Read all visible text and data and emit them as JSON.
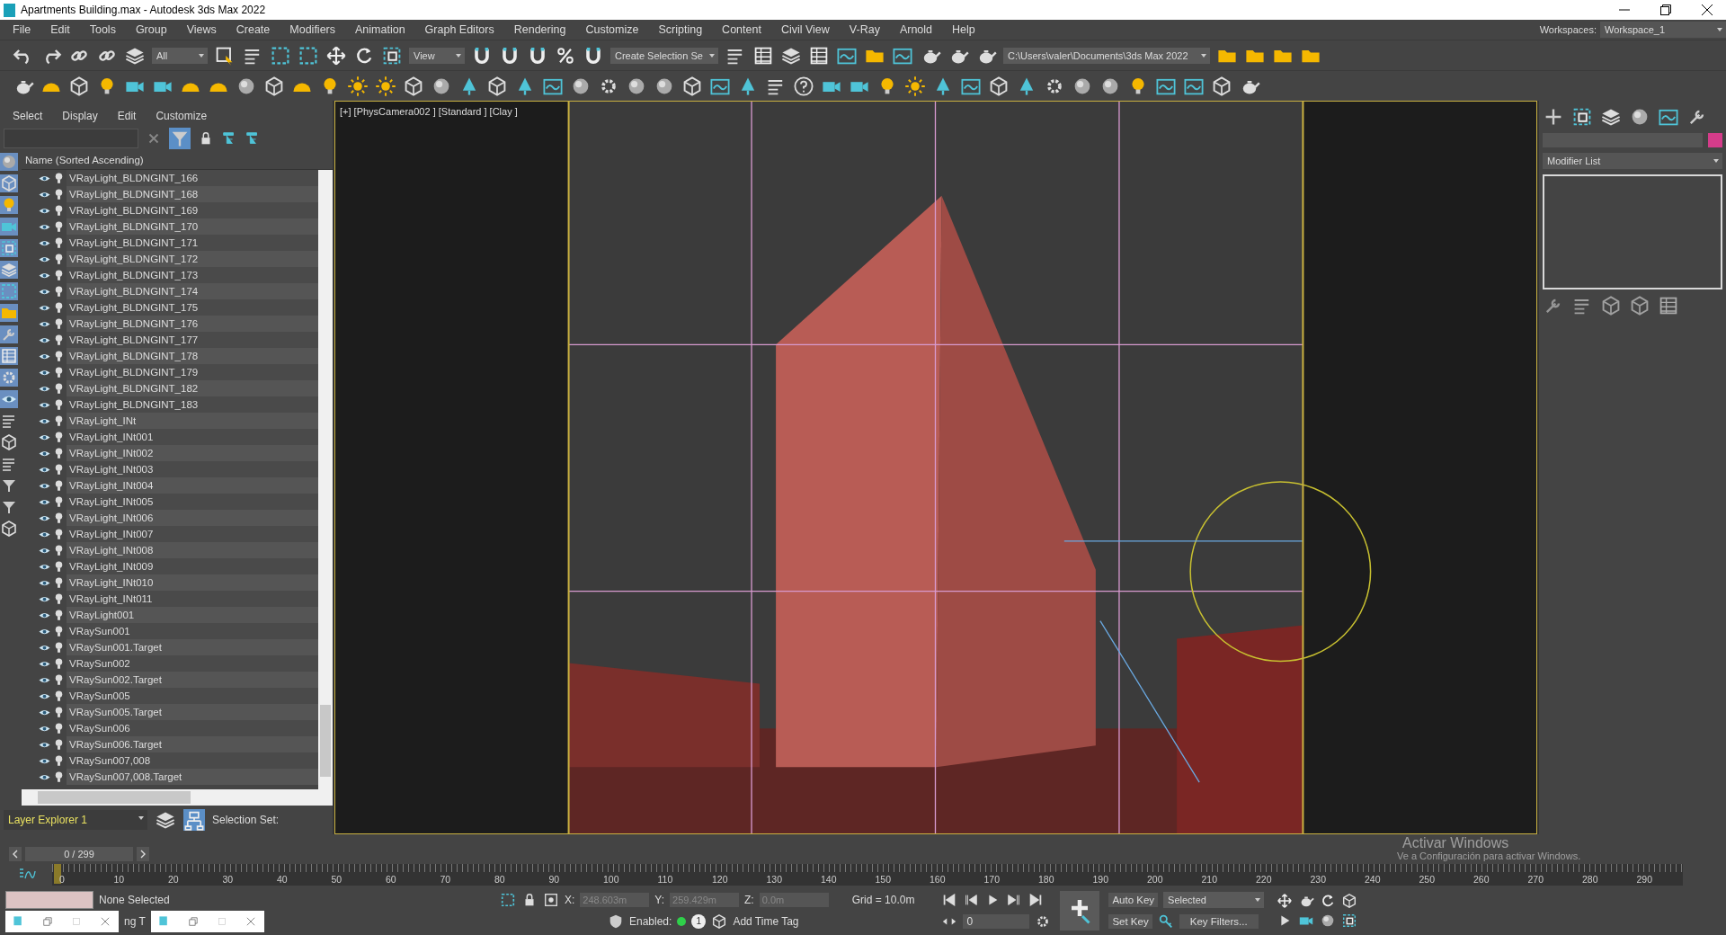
{
  "window": {
    "title": "Apartments Building.max - Autodesk 3ds Max 2022"
  },
  "menu": [
    "File",
    "Edit",
    "Tools",
    "Group",
    "Views",
    "Create",
    "Modifiers",
    "Animation",
    "Graph Editors",
    "Rendering",
    "Customize",
    "Scripting",
    "Content",
    "Civil View",
    "V-Ray",
    "Arnold",
    "Help"
  ],
  "workspaces": {
    "label": "Workspaces:",
    "value": "Workspace_1"
  },
  "toolbar": {
    "selection_filter": "All",
    "reference_coordinate": "View",
    "named_selection": "Create Selection Se",
    "project_path": "C:\\Users\\valer\\Documents\\3ds Max 2022"
  },
  "scene_explorer": {
    "menu": [
      "Select",
      "Display",
      "Edit",
      "Customize"
    ],
    "filter_on": true,
    "column": "Name (Sorted Ascending)",
    "items": [
      "VRayLight_BLDNGINT_166",
      "VRayLight_BLDNGINT_168",
      "VRayLight_BLDNGINT_169",
      "VRayLight_BLDNGINT_170",
      "VRayLight_BLDNGINT_171",
      "VRayLight_BLDNGINT_172",
      "VRayLight_BLDNGINT_173",
      "VRayLight_BLDNGINT_174",
      "VRayLight_BLDNGINT_175",
      "VRayLight_BLDNGINT_176",
      "VRayLight_BLDNGINT_177",
      "VRayLight_BLDNGINT_178",
      "VRayLight_BLDNGINT_179",
      "VRayLight_BLDNGINT_182",
      "VRayLight_BLDNGINT_183",
      "VRayLight_INt",
      "VRayLight_INt001",
      "VRayLight_INt002",
      "VRayLight_INt003",
      "VRayLight_INt004",
      "VRayLight_INt005",
      "VRayLight_INt006",
      "VRayLight_INt007",
      "VRayLight_INt008",
      "VRayLight_INt009",
      "VRayLight_INt010",
      "VRayLight_INt011",
      "VRayLight001",
      "VRaySun001",
      "VRaySun001.Target",
      "VRaySun002",
      "VRaySun002.Target",
      "VRaySun005",
      "VRaySun005.Target",
      "VRaySun006",
      "VRaySun006.Target",
      "VRaySun007,008",
      "VRaySun007,008.Target"
    ],
    "explorer_name": "Layer Explorer 1",
    "selection_set_label": "Selection Set:"
  },
  "viewport": {
    "label": "[+] [PhysCamera002 ] [Standard ] [Clay ]"
  },
  "command_panel": {
    "modifier_list": "Modifier List"
  },
  "timeline": {
    "frame_counter": "0 / 299",
    "ticks": [
      "0",
      "10",
      "20",
      "30",
      "40",
      "50",
      "60",
      "70",
      "80",
      "90",
      "100",
      "110",
      "120",
      "130",
      "140",
      "150",
      "160",
      "170",
      "180",
      "190",
      "200",
      "210",
      "220",
      "230",
      "240",
      "250",
      "260",
      "270",
      "280",
      "290"
    ]
  },
  "status": {
    "selection": "None Selected",
    "partial_text": "ng T",
    "x_label": "X:",
    "x": "248.603m",
    "y_label": "Y:",
    "y": "259.429m",
    "z_label": "Z:",
    "z": "0.0m",
    "grid": "Grid = 10.0m",
    "enabled_label": "Enabled:",
    "enabled_count": "1",
    "add_time_tag": "Add Time Tag",
    "frame": "0",
    "auto_key": "Auto Key",
    "set_key_filter": "Selected",
    "set_key": "Set Key",
    "key_filters": "Key Filters..."
  },
  "os_notice": {
    "title": "Activar Windows",
    "message": "Ve a Configuración para activar Windows."
  }
}
